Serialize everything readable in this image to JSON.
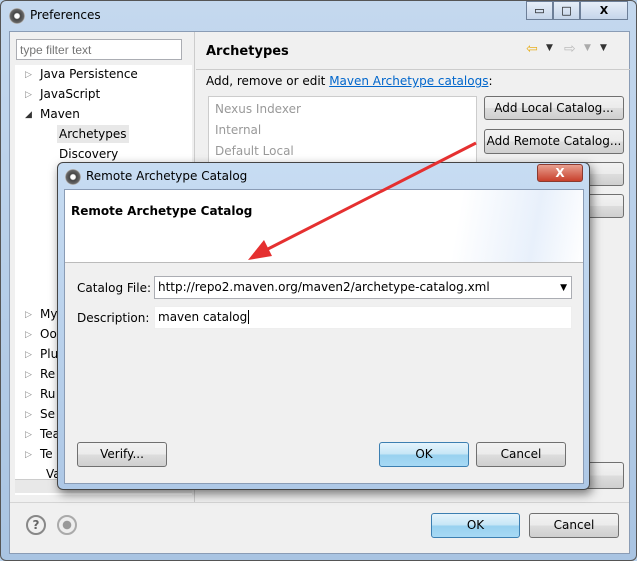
{
  "window": {
    "title": "Preferences",
    "minimize": "▭",
    "maximize": "□",
    "close": "X"
  },
  "filter": {
    "placeholder": "type filter text"
  },
  "tree": {
    "items": [
      {
        "label": "Java Persistence",
        "twisty": "▷"
      },
      {
        "label": "JavaScript",
        "twisty": "▷"
      },
      {
        "label": "Maven",
        "twisty": "◢"
      },
      {
        "label": "Archetypes",
        "selected": true
      },
      {
        "label": "Discovery"
      }
    ],
    "partial_items": [
      "My",
      "Oo",
      "Plu",
      "Re",
      "Ru",
      "Se",
      "Tea",
      "Te",
      "Va"
    ]
  },
  "page": {
    "title": "Archetypes",
    "description_prefix": "Add, remove or edit ",
    "link": "Maven Archetype catalogs",
    "description_suffix": ":",
    "catalogs": [
      "Nexus Indexer",
      "Internal",
      "Default Local"
    ],
    "buttons": {
      "add_local": "Add Local Catalog...",
      "add_remote": "Add Remote Catalog..."
    }
  },
  "footer": {
    "ok": "OK",
    "cancel": "Cancel"
  },
  "dialog": {
    "title": "Remote Archetype Catalog",
    "close": "X",
    "banner_title": "Remote Archetype Catalog",
    "catalog_file_label": "Catalog File:",
    "catalog_file_value": "http://repo2.maven.org/maven2/archetype-catalog.xml",
    "description_label": "Description:",
    "description_value": "maven catalog",
    "verify": "Verify...",
    "ok": "OK",
    "cancel": "Cancel"
  },
  "colors": {
    "link": "#0066cc",
    "arrow": "#e53030",
    "default_button": "#3c7fb1"
  }
}
